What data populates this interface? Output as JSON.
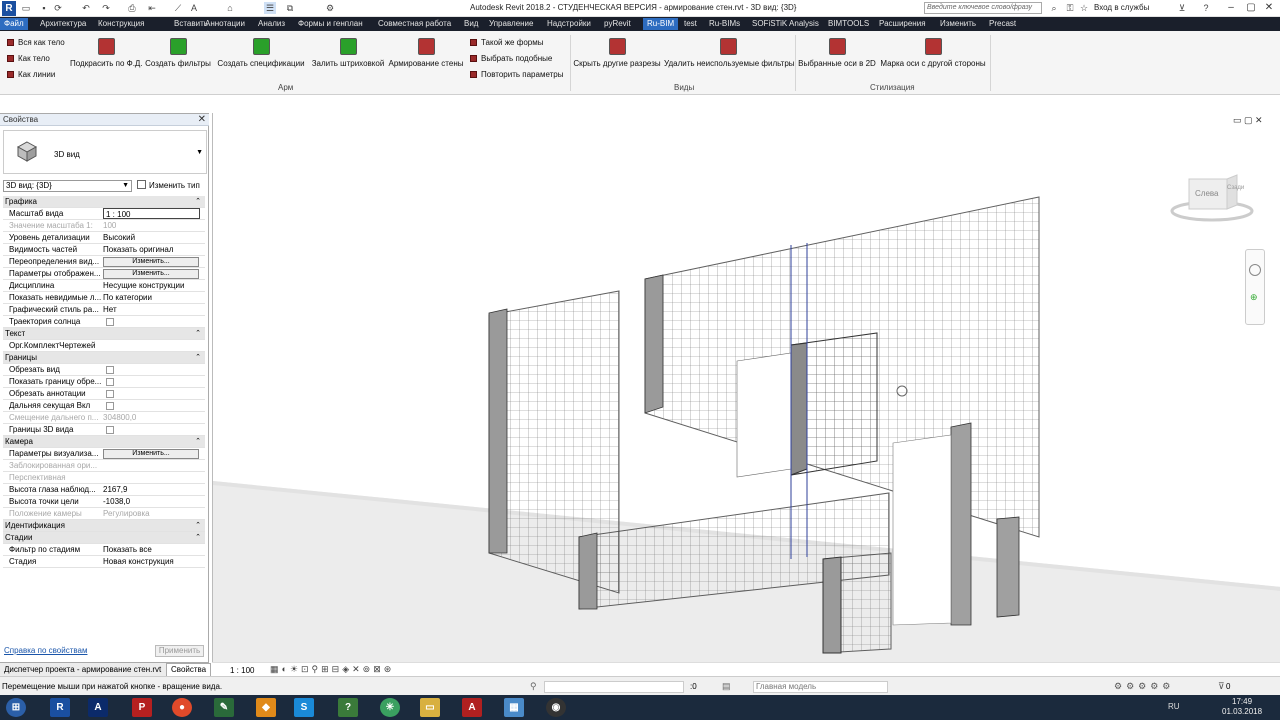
{
  "window": {
    "title": "Autodesk Revit 2018.2 - СТУДЕНЧЕСКАЯ ВЕРСИЯ -    армирование стен.rvt - 3D вид: {3D}",
    "search_placeholder": "Введите ключевое слово/фразу",
    "login": "Вход в службы"
  },
  "menu": {
    "tabs": [
      "Файл",
      "Архитектура",
      "Конструкция",
      "Вставить",
      "Аннотации",
      "Анализ",
      "Формы и генплан",
      "Совместная работа",
      "Вид",
      "Управление",
      "Надстройки",
      "pyRevit",
      "Ru-BIM",
      "test",
      "Ru-BIMs",
      "SOFiSTiK Analysis",
      "BIMTOOLS",
      "Расширения",
      "Изменить",
      "Precast"
    ],
    "active": "Ru-BIM"
  },
  "ribbon": {
    "small_left": [
      "Вся как тело",
      "Как тело",
      "Как линии"
    ],
    "buttons": [
      {
        "label": "Подкрасить по Ф.Д.",
        "color": "red"
      },
      {
        "label": "Создать фильтры",
        "color": "green"
      },
      {
        "label": "Создать спецификации",
        "color": "green"
      },
      {
        "label": "Залить штриховкой",
        "color": "green"
      },
      {
        "label": "Армирование стены",
        "color": "red"
      }
    ],
    "small_mid": [
      "Такой же формы",
      "Выбрать подобные",
      "Повторить параметры"
    ],
    "buttons2": [
      {
        "label": "Скрыть другие разрезы",
        "color": "red"
      },
      {
        "label": "Удалить неиспользуемые фильтры",
        "color": "red"
      },
      {
        "label": "Выбранные оси в 2D",
        "color": "red"
      },
      {
        "label": "Марка оси с другой стороны",
        "color": "red"
      }
    ],
    "panels": [
      "Арм",
      "Виды",
      "Стилизация"
    ]
  },
  "properties": {
    "title": "Свойства",
    "type_name": "3D вид",
    "view_dropdown": "3D вид: {3D}",
    "edit_type": "Изменить тип",
    "rows": [
      {
        "kind": "group",
        "name": "Графика"
      },
      {
        "kind": "input",
        "name": "Масштаб вида",
        "value": "1 : 100"
      },
      {
        "kind": "dim",
        "name": "Значение масштаба    1:",
        "value": "100"
      },
      {
        "kind": "text",
        "name": "Уровень детализации",
        "value": "Высокий"
      },
      {
        "kind": "text",
        "name": "Видимость частей",
        "value": "Показать оригинал"
      },
      {
        "kind": "button",
        "name": "Переопределения вид...",
        "value": "Изменить..."
      },
      {
        "kind": "button",
        "name": "Параметры отображен...",
        "value": "Изменить..."
      },
      {
        "kind": "text",
        "name": "Дисциплина",
        "value": "Несущие конструкции"
      },
      {
        "kind": "text",
        "name": "Показать невидимые л...",
        "value": "По категории"
      },
      {
        "kind": "text",
        "name": "Графический стиль ра...",
        "value": "Нет"
      },
      {
        "kind": "check",
        "name": "Траектория солнца",
        "value": ""
      },
      {
        "kind": "group",
        "name": "Текст"
      },
      {
        "kind": "text",
        "name": "Орг.КомплектЧертежей",
        "value": ""
      },
      {
        "kind": "group",
        "name": "Границы"
      },
      {
        "kind": "check",
        "name": "Обрезать вид",
        "value": ""
      },
      {
        "kind": "check",
        "name": "Показать границу обре...",
        "value": ""
      },
      {
        "kind": "check",
        "name": "Обрезать аннотации",
        "value": ""
      },
      {
        "kind": "check",
        "name": "Дальняя секущая Вкл",
        "value": ""
      },
      {
        "kind": "dim",
        "name": "Смещение дальнего п...",
        "value": "304800,0"
      },
      {
        "kind": "check",
        "name": "Границы 3D вида",
        "value": ""
      },
      {
        "kind": "group",
        "name": "Камера"
      },
      {
        "kind": "button",
        "name": "Параметры визуализа...",
        "value": "Изменить..."
      },
      {
        "kind": "dim",
        "name": "Заблокированная ори...",
        "value": ""
      },
      {
        "kind": "dim",
        "name": "Перспективная",
        "value": ""
      },
      {
        "kind": "text",
        "name": "Высота глаза наблюд...",
        "value": "2167,9"
      },
      {
        "kind": "text",
        "name": "Высота точки цели",
        "value": "-1038,0"
      },
      {
        "kind": "dim",
        "name": "Положение камеры",
        "value": "Регулировка"
      },
      {
        "kind": "group",
        "name": "Идентификация"
      },
      {
        "kind": "group",
        "name": "Стадии"
      },
      {
        "kind": "text",
        "name": "Фильтр по стадиям",
        "value": "Показать все"
      },
      {
        "kind": "text",
        "name": "Стадия",
        "value": "Новая конструкция"
      }
    ],
    "help_link": "Справка по свойствам",
    "apply": "Применить",
    "tab_browser": "Диспетчер проекта - армирование стен.rvt",
    "tab_props": "Свойства"
  },
  "viewport": {
    "scale": "1 : 100",
    "viewcube_labels": [
      "Слева",
      "Сзади"
    ]
  },
  "status": {
    "text": "Перемещение мыши при нажатой кнопке - вращение вида.",
    "coord": ":0",
    "model": "Главная модель",
    "count": "0"
  },
  "taskbar": {
    "lang": "RU",
    "time": "17:49",
    "date": "01.03.2018"
  },
  "colors": {
    "accent": "#2d6cc0",
    "menubar": "#1a1f2b",
    "button_red": "#b33333",
    "button_green": "#2aa02a"
  }
}
